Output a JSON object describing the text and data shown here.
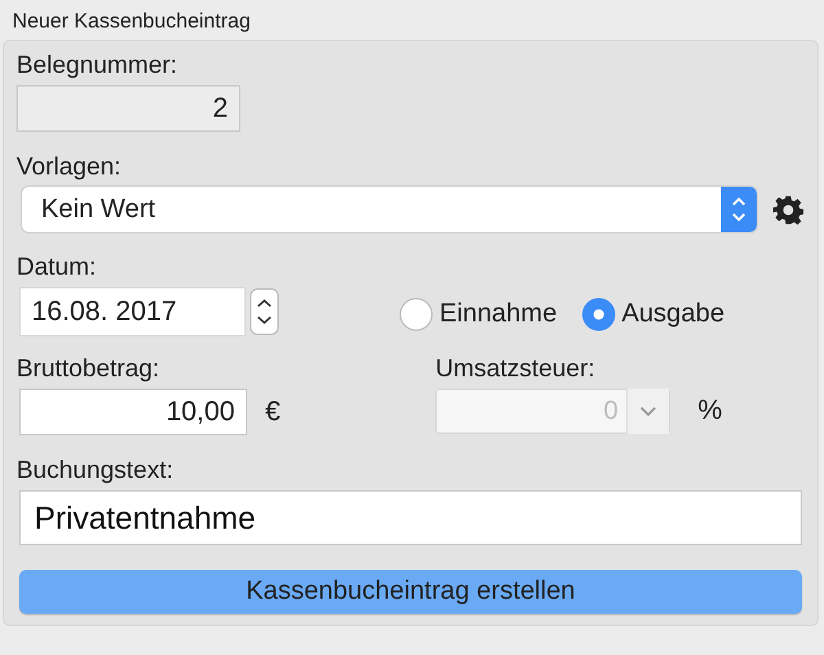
{
  "window": {
    "title": "Neuer Kassenbucheintrag"
  },
  "belegnummer": {
    "label": "Belegnummer:",
    "value": "2",
    "disabled": true
  },
  "vorlagen": {
    "label": "Vorlagen:",
    "value": "Kein Wert"
  },
  "datum": {
    "label": "Datum:",
    "value": "16.08. 2017"
  },
  "type_options": [
    {
      "label": "Einnahme",
      "selected": false
    },
    {
      "label": "Ausgabe",
      "selected": true
    }
  ],
  "bruttobetrag": {
    "label": "Bruttobetrag:",
    "value": "10,00",
    "unit": "€"
  },
  "umsatzsteuer": {
    "label": "Umsatzsteuer:",
    "value": "0",
    "unit": "%",
    "disabled": true
  },
  "buchungstext": {
    "label": "Buchungstext:",
    "value": "Privatentnahme"
  },
  "submit_button": "Kassenbucheintrag erstellen"
}
